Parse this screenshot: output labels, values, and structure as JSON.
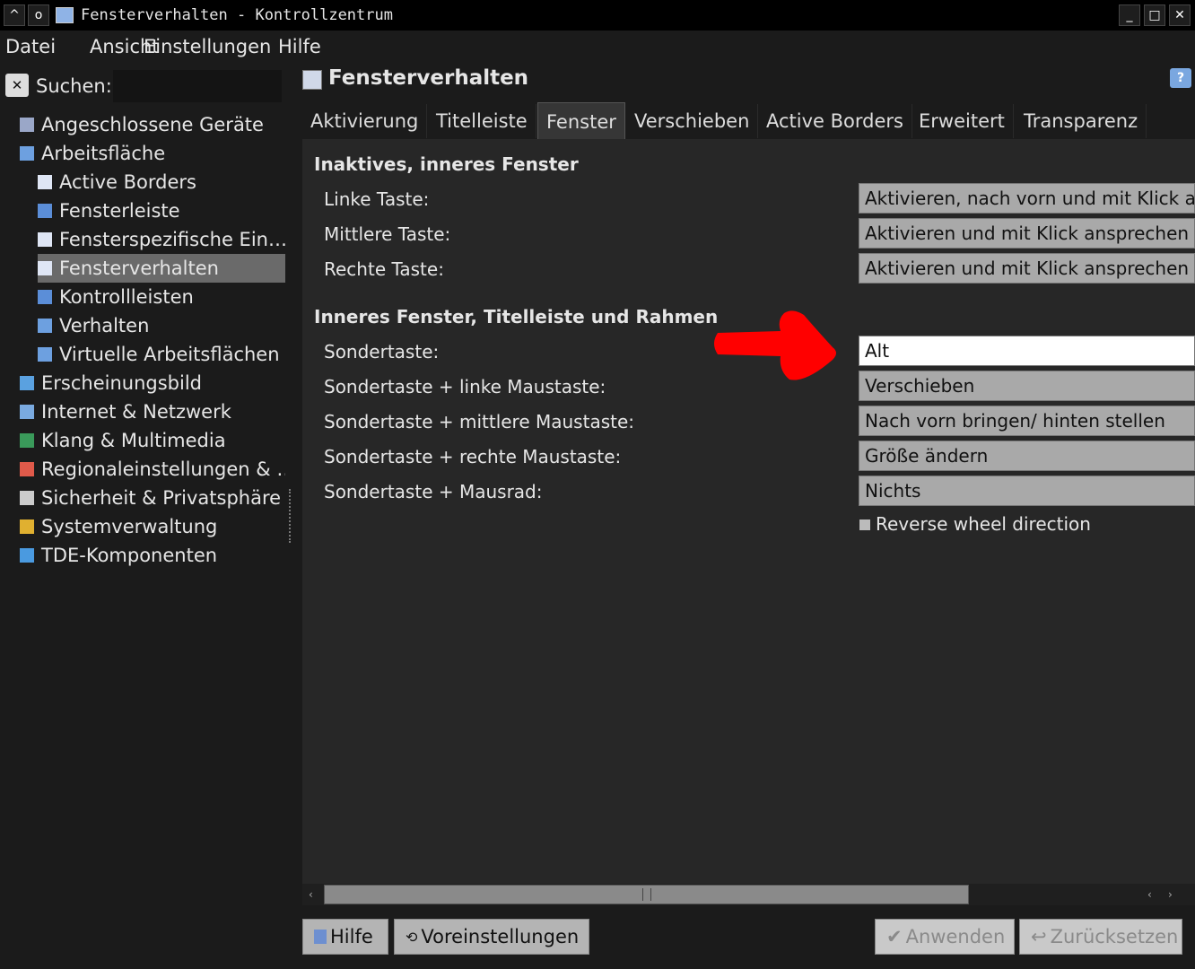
{
  "window": {
    "title": "Fensterverhalten - Kontrollzentrum",
    "controls": {
      "minimize": "_",
      "maximize": "□",
      "close": "✕",
      "up": "^",
      "sticky": "o"
    }
  },
  "menu": [
    "Datei",
    "Ansicht",
    "Einstellungen",
    "Hilfe"
  ],
  "search": {
    "label": "Suchen:",
    "value": ""
  },
  "sidebar": {
    "items": [
      {
        "label": "Angeschlossene Geräte",
        "level": 0,
        "arrow": "›",
        "icon": "devices-icon",
        "color": "#9aa7c8"
      },
      {
        "label": "Arbeitsfläche",
        "level": 0,
        "arrow": "⌄",
        "icon": "desktop-icon",
        "color": "#6da0e0"
      },
      {
        "label": "Active Borders",
        "level": 1,
        "icon": "window-icon",
        "color": "#dfe6f5"
      },
      {
        "label": "Fensterleiste",
        "level": 1,
        "icon": "taskbar-icon",
        "color": "#5b8ed8"
      },
      {
        "label": "Fensterspezifische Ein…",
        "level": 1,
        "icon": "window-icon",
        "color": "#dfe6f5"
      },
      {
        "label": "Fensterverhalten",
        "level": 1,
        "icon": "window-icon",
        "color": "#dfe6f5",
        "selected": true
      },
      {
        "label": "Kontrollleisten",
        "level": 1,
        "icon": "panel-icon",
        "color": "#5b8ed8"
      },
      {
        "label": "Verhalten",
        "level": 1,
        "icon": "desktop-icon",
        "color": "#6da0e0"
      },
      {
        "label": "Virtuelle Arbeitsflächen",
        "level": 1,
        "icon": "desktop-icon",
        "color": "#6da0e0"
      },
      {
        "label": "Erscheinungsbild",
        "level": 0,
        "arrow": "›",
        "icon": "appearance-icon",
        "color": "#5aa1e0"
      },
      {
        "label": "Internet & Netzwerk",
        "level": 0,
        "arrow": "›",
        "icon": "globe-icon",
        "color": "#7aaae0"
      },
      {
        "label": "Klang & Multimedia",
        "level": 0,
        "arrow": "›",
        "icon": "sound-icon",
        "color": "#3a9a5a"
      },
      {
        "label": "Regionaleinstellungen & …",
        "level": 0,
        "arrow": "›",
        "icon": "region-icon",
        "color": "#e05a4a"
      },
      {
        "label": "Sicherheit & Privatsphäre",
        "level": 0,
        "arrow": "›",
        "icon": "security-icon",
        "color": "#cccccc"
      },
      {
        "label": "Systemverwaltung",
        "level": 0,
        "arrow": "›",
        "icon": "system-icon",
        "color": "#e0b030"
      },
      {
        "label": "TDE-Komponenten",
        "level": 0,
        "arrow": "›",
        "icon": "components-icon",
        "color": "#4a9ae0"
      }
    ]
  },
  "header": {
    "title": "Fensterverhalten",
    "help": "?"
  },
  "tabs": [
    "Aktivierung",
    "Titelleiste",
    "Fenster",
    "Verschieben",
    "Active Borders",
    "Erweitert",
    "Transparenz"
  ],
  "active_tab": "Fenster",
  "sections": {
    "inactive": {
      "title": "Inaktives, inneres Fenster",
      "rows": [
        {
          "label": "Linke Taste:",
          "value": "Aktivieren, nach vorn und mit Klick a"
        },
        {
          "label": "Mittlere Taste:",
          "value": "Aktivieren und mit Klick ansprechen"
        },
        {
          "label": "Rechte Taste:",
          "value": "Aktivieren und mit Klick ansprechen"
        }
      ]
    },
    "inner": {
      "title": "Inneres Fenster, Titelleiste und Rahmen",
      "rows": [
        {
          "label": "Sondertaste:",
          "value": "Alt"
        },
        {
          "label": "Sondertaste + linke Maustaste:",
          "value": "Verschieben"
        },
        {
          "label": "Sondertaste + mittlere Maustaste:",
          "value": "Nach vorn bringen/ hinten stellen"
        },
        {
          "label": "Sondertaste + rechte Maustaste:",
          "value": "Größe ändern"
        },
        {
          "label": "Sondertaste + Mausrad:",
          "value": "Nichts"
        }
      ],
      "checkbox": {
        "label": "Reverse wheel direction",
        "checked": false
      }
    }
  },
  "buttons": {
    "help": "Hilfe",
    "defaults": "Voreinstellungen",
    "apply": "Anwenden",
    "reset": "Zurücksetzen"
  },
  "colors": {
    "annotation": "#ff0000",
    "selection": "#6a6a6a"
  }
}
